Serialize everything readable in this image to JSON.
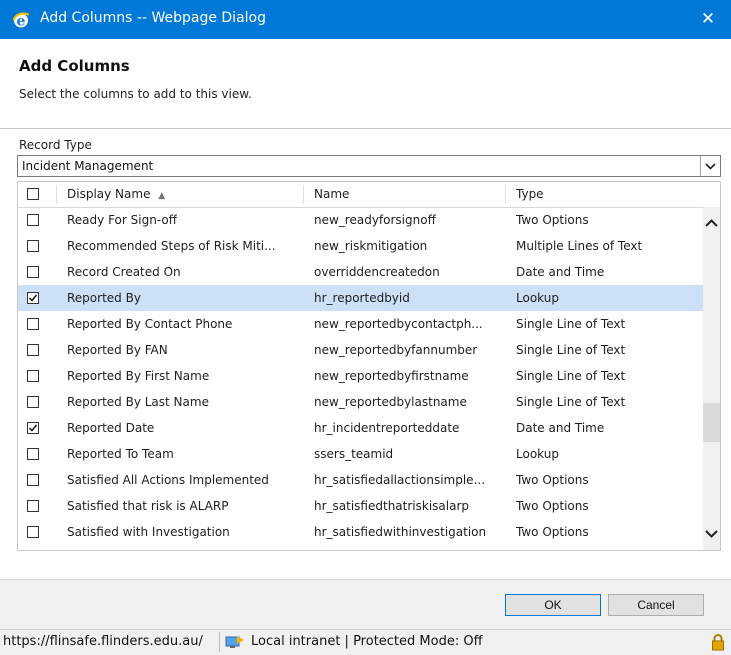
{
  "window": {
    "title": "Add Columns -- Webpage Dialog",
    "close_glyph": "✕"
  },
  "header": {
    "title": "Add Columns",
    "subtitle": "Select the columns to add to this view."
  },
  "record_type": {
    "label": "Record Type",
    "selected": "Incident Management"
  },
  "table": {
    "columns": [
      "Display Name",
      "Name",
      "Type"
    ],
    "sort_indicator": "▲",
    "rows": [
      {
        "display": "Ready For Sign-off",
        "name": "new_readyforsignoff",
        "type": "Two Options",
        "checked": false
      },
      {
        "display": "Recommended Steps of Risk Miti...",
        "name": "new_riskmitigation",
        "type": "Multiple Lines of Text",
        "checked": false
      },
      {
        "display": "Record Created On",
        "name": "overriddencreatedon",
        "type": "Date and Time",
        "checked": false
      },
      {
        "display": "Reported By",
        "name": "hr_reportedbyid",
        "type": "Lookup",
        "checked": true,
        "selected": true
      },
      {
        "display": "Reported By Contact Phone",
        "name": "new_reportedbycontactph...",
        "type": "Single Line of Text",
        "checked": false
      },
      {
        "display": "Reported By FAN",
        "name": "new_reportedbyfannumber",
        "type": "Single Line of Text",
        "checked": false
      },
      {
        "display": "Reported By First Name",
        "name": "new_reportedbyfirstname",
        "type": "Single Line of Text",
        "checked": false
      },
      {
        "display": "Reported By Last Name",
        "name": "new_reportedbylastname",
        "type": "Single Line of Text",
        "checked": false
      },
      {
        "display": "Reported Date",
        "name": "hr_incidentreporteddate",
        "type": "Date and Time",
        "checked": true
      },
      {
        "display": "Reported To Team",
        "name": "ssers_teamid",
        "type": "Lookup",
        "checked": false
      },
      {
        "display": "Satisfied All Actions Implemented",
        "name": "hr_satisfiedallactionsimple...",
        "type": "Two Options",
        "checked": false
      },
      {
        "display": "Satisfied that risk is ALARP",
        "name": "hr_satisfiedthatriskisalarp",
        "type": "Two Options",
        "checked": false
      },
      {
        "display": "Satisfied with Investigation",
        "name": "hr_satisfiedwithinvestigation",
        "type": "Two Options",
        "checked": false
      }
    ]
  },
  "buttons": {
    "ok": "OK",
    "cancel": "Cancel"
  },
  "status": {
    "url": "https://flinsafe.flinders.edu.au/",
    "zone": "Local intranet | Protected Mode: Off"
  },
  "colors": {
    "titlebar": "#0078d7",
    "selected_row": "#cce1f8"
  },
  "icons": [
    "ie-logo-icon",
    "close-icon",
    "checkbox-icon",
    "chevron-down-icon",
    "chevron-up-icon",
    "local-intranet-icon",
    "lock-icon"
  ]
}
